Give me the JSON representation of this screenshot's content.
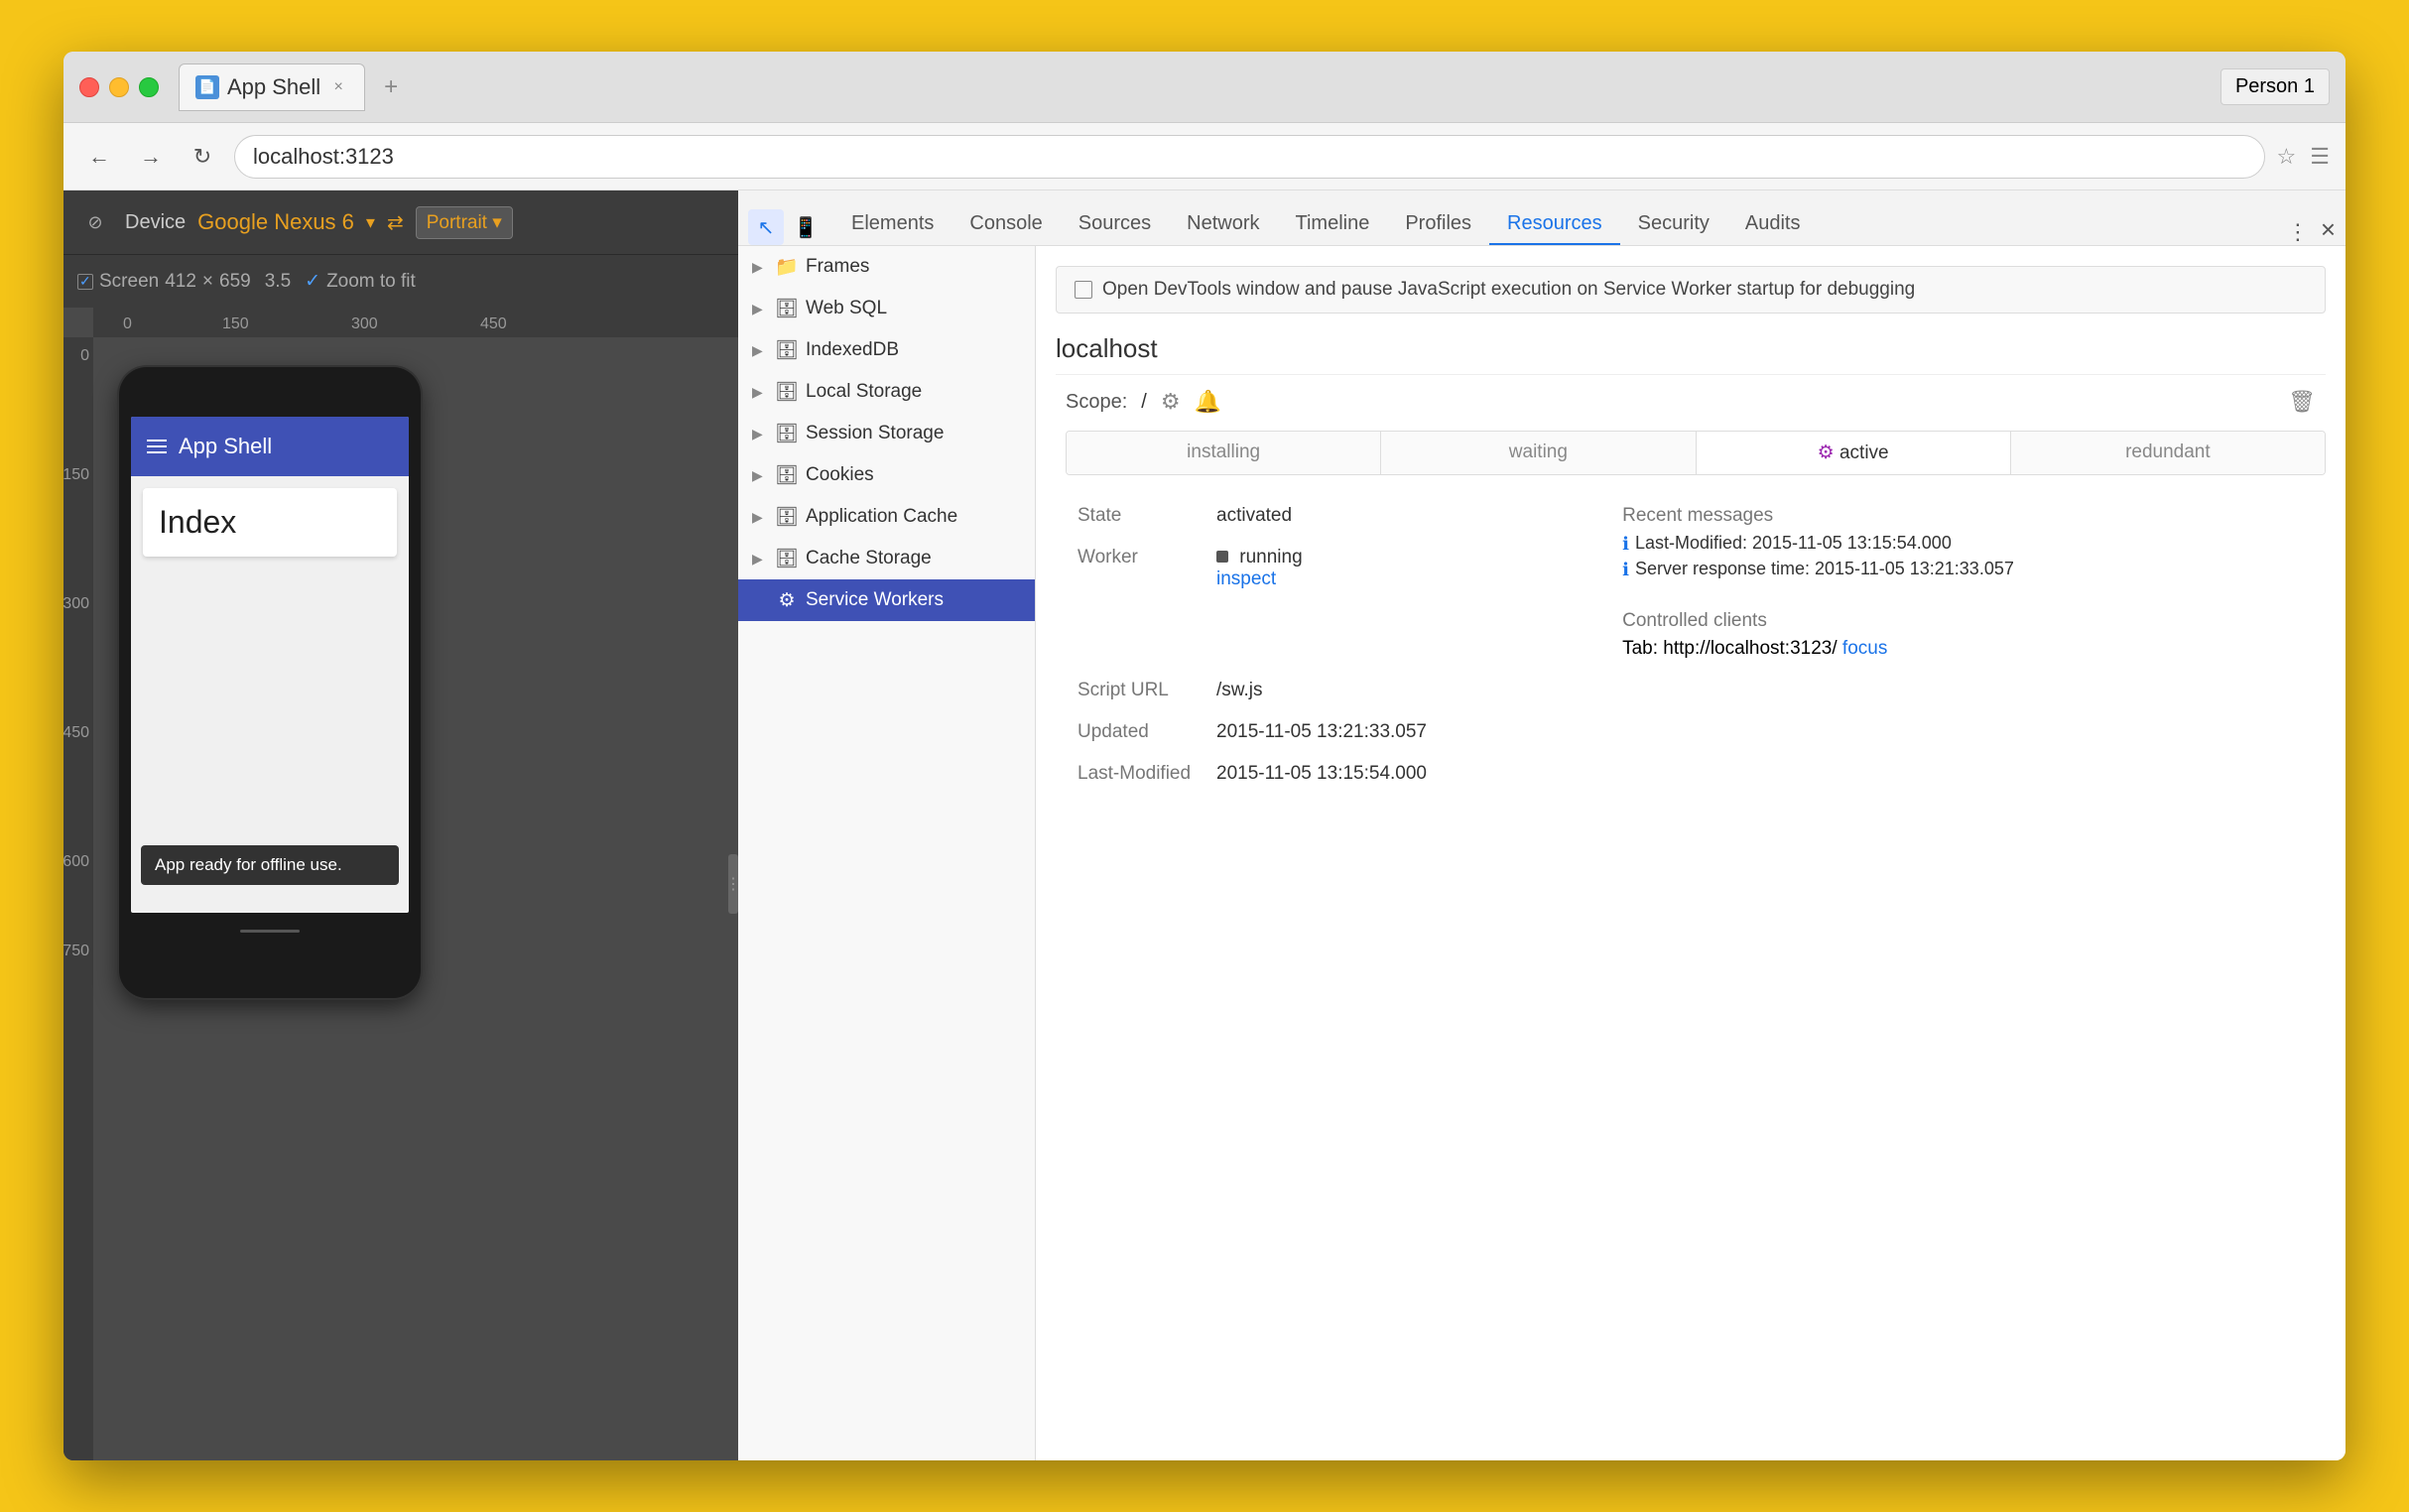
{
  "browser": {
    "tab_title": "App Shell",
    "tab_icon": "📄",
    "close_tab_label": "×",
    "new_tab_label": "+",
    "person_label": "Person 1",
    "nav_back_title": "Back",
    "nav_forward_title": "Forward",
    "nav_reload_title": "Reload",
    "address": "localhost:3123",
    "bookmark_title": "Bookmark",
    "menu_title": "Menu"
  },
  "device_toolbar": {
    "device_toggle_title": "Toggle device toolbar",
    "device_label": "Device",
    "device_name": "Google Nexus 6",
    "swap_label": "⇄",
    "rotate_label": "↻",
    "portrait_label": "Portrait ▾",
    "screen_label": "Screen",
    "screen_w": "412",
    "screen_x": "×",
    "screen_h": "659",
    "zoom_label": "3.5",
    "zoom_to_fit_label": "Zoom to fit"
  },
  "phone": {
    "app_title": "App Shell",
    "index_text": "Index",
    "snackbar_text": "App ready for offline use."
  },
  "devtools": {
    "tabs": [
      {
        "id": "elements",
        "label": "Elements"
      },
      {
        "id": "console",
        "label": "Console"
      },
      {
        "id": "sources",
        "label": "Sources"
      },
      {
        "id": "network",
        "label": "Network"
      },
      {
        "id": "timeline",
        "label": "Timeline"
      },
      {
        "id": "profiles",
        "label": "Profiles"
      },
      {
        "id": "resources",
        "label": "Resources"
      },
      {
        "id": "security",
        "label": "Security"
      },
      {
        "id": "audits",
        "label": "Audits"
      }
    ],
    "active_tab": "resources",
    "more_label": "⋮",
    "close_label": "×",
    "cursor_tool_title": "Inspect element",
    "mobile_tool_title": "Toggle device toolbar"
  },
  "resources_sidebar": {
    "items": [
      {
        "id": "frames",
        "label": "Frames",
        "hasArrow": true,
        "icon": "folder"
      },
      {
        "id": "websql",
        "label": "Web SQL",
        "hasArrow": true,
        "icon": "db"
      },
      {
        "id": "indexeddb",
        "label": "IndexedDB",
        "hasArrow": true,
        "icon": "db"
      },
      {
        "id": "local-storage",
        "label": "Local Storage",
        "hasArrow": true,
        "icon": "db"
      },
      {
        "id": "session-storage",
        "label": "Session Storage",
        "hasArrow": true,
        "icon": "db"
      },
      {
        "id": "cookies",
        "label": "Cookies",
        "hasArrow": true,
        "icon": "db"
      },
      {
        "id": "app-cache",
        "label": "Application Cache",
        "hasArrow": true,
        "icon": "db"
      },
      {
        "id": "cache-storage",
        "label": "Cache Storage",
        "hasArrow": true,
        "icon": "db"
      },
      {
        "id": "service-workers",
        "label": "Service Workers",
        "hasArrow": false,
        "icon": "gear",
        "selected": true
      }
    ]
  },
  "service_workers": {
    "banner_text": "Open DevTools window and pause JavaScript execution on Service Worker startup for debugging",
    "host": "localhost",
    "scope_label": "Scope:",
    "scope_value": "/",
    "status_tabs": [
      {
        "id": "installing",
        "label": "installing"
      },
      {
        "id": "waiting",
        "label": "waiting"
      },
      {
        "id": "active",
        "label": "active",
        "active": true
      },
      {
        "id": "redundant",
        "label": "redundant"
      }
    ],
    "state_label": "State",
    "state_value": "activated",
    "worker_label": "Worker",
    "worker_running": "running",
    "worker_inspect": "inspect",
    "script_url_label": "Script URL",
    "script_url_value": "/sw.js",
    "updated_label": "Updated",
    "updated_value": "2015-11-05 13:21:33.057",
    "last_modified_label": "Last-Modified",
    "last_modified_value": "2015-11-05 13:15:54.000",
    "recent_messages_label": "Recent messages",
    "messages": [
      "Last-Modified: 2015-11-05 13:15:54.000",
      "Server response time: 2015-11-05 13:21:33.057"
    ],
    "controlled_clients_label": "Controlled clients",
    "clients": [
      {
        "prefix": "Tab: http://localhost:3123/",
        "link_text": "focus"
      }
    ]
  }
}
